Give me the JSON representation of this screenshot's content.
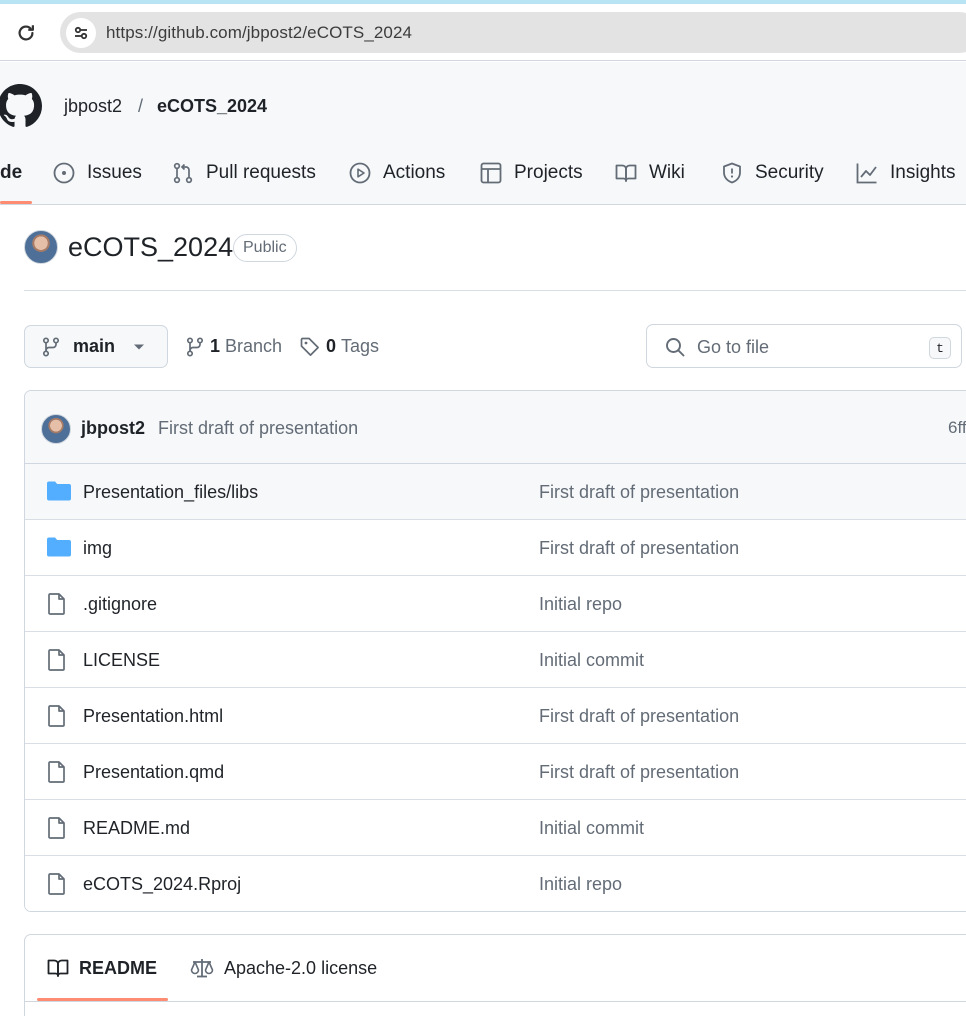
{
  "browser": {
    "url": "https://github.com/jbpost2/eCOTS_2024"
  },
  "header": {
    "owner": "jbpost2",
    "separator": "/",
    "repo": "eCOTS_2024",
    "tabs": [
      {
        "label": "de",
        "icon": "code-icon",
        "active": true
      },
      {
        "label": "Issues",
        "icon": "issue-icon"
      },
      {
        "label": "Pull requests",
        "icon": "pull-request-icon"
      },
      {
        "label": "Actions",
        "icon": "play-icon"
      },
      {
        "label": "Projects",
        "icon": "table-icon"
      },
      {
        "label": "Wiki",
        "icon": "book-icon"
      },
      {
        "label": "Security",
        "icon": "shield-icon"
      },
      {
        "label": "Insights",
        "icon": "graph-icon"
      }
    ]
  },
  "repo": {
    "title": "eCOTS_2024",
    "visibility": "Public"
  },
  "branch_bar": {
    "branch": "main",
    "branch_count": "1",
    "branch_label": "Branch",
    "tag_count": "0",
    "tag_label": "Tags",
    "goto_placeholder": "Go to file",
    "goto_shortcut": "t"
  },
  "latest_commit": {
    "author": "jbpost2",
    "message": "First draft of presentation",
    "hash": "6ff"
  },
  "files": [
    {
      "name": "Presentation_files/libs",
      "type": "folder",
      "message": "First draft of presentation"
    },
    {
      "name": "img",
      "type": "folder",
      "message": "First draft of presentation"
    },
    {
      "name": ".gitignore",
      "type": "file",
      "message": "Initial repo"
    },
    {
      "name": "LICENSE",
      "type": "file",
      "message": "Initial commit"
    },
    {
      "name": "Presentation.html",
      "type": "file",
      "message": "First draft of presentation"
    },
    {
      "name": "Presentation.qmd",
      "type": "file",
      "message": "First draft of presentation"
    },
    {
      "name": "README.md",
      "type": "file",
      "message": "Initial commit"
    },
    {
      "name": "eCOTS_2024.Rproj",
      "type": "file",
      "message": "Initial repo"
    }
  ],
  "readme": {
    "tab_readme": "README",
    "tab_license": "Apache-2.0 license"
  },
  "colors": {
    "accent_underline": "#fd8c73",
    "folder": "#54aeff",
    "muted_text": "#636c76"
  }
}
